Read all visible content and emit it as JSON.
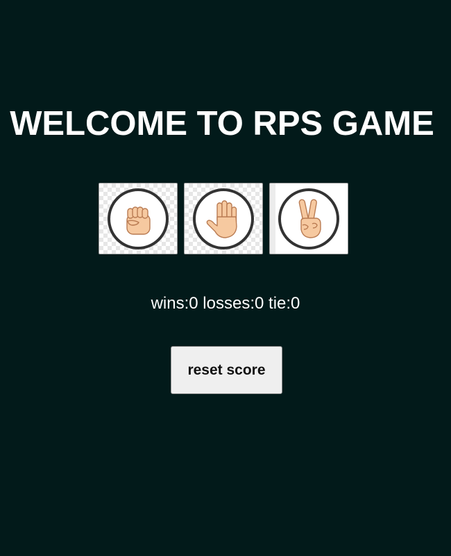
{
  "title": "WELCOME TO RPS GAME",
  "moves": [
    {
      "name": "rock",
      "icon": "fist-icon"
    },
    {
      "name": "paper",
      "icon": "open-hand-icon"
    },
    {
      "name": "scissors",
      "icon": "peace-sign-icon"
    }
  ],
  "score": {
    "wins_label": "wins:",
    "wins": "0",
    "losses_label": "losses:",
    "losses": "0",
    "tie_label": "tie:",
    "tie": "0"
  },
  "reset_label": "reset score",
  "colors": {
    "background": "#021a1a",
    "skin": "#f6c9a0",
    "skin_outline": "#b97b52",
    "circle": "#333333"
  }
}
